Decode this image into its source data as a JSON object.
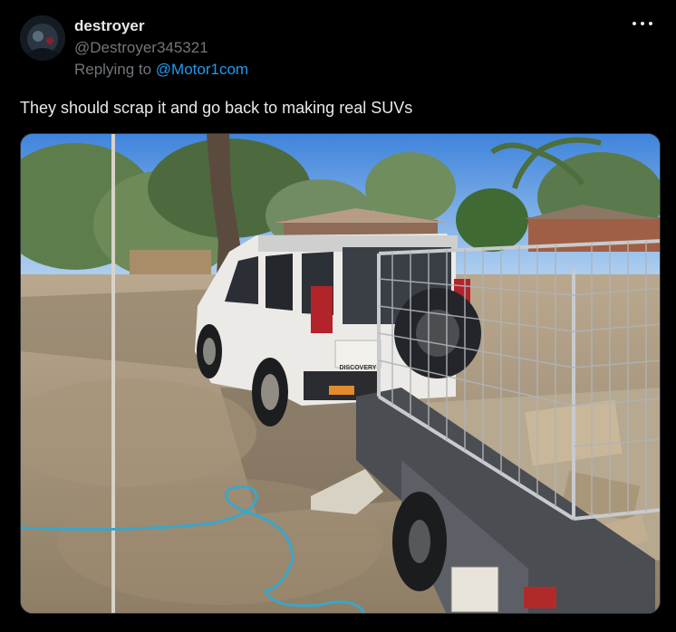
{
  "tweet": {
    "display_name": "destroyer",
    "handle": "@Destroyer345321",
    "replying_prefix": "Replying to ",
    "replying_mention": "@Motor1com",
    "text": "They should scrap it and go back to making real SUVs",
    "more_icon": "more-horizontal-icon"
  },
  "media": {
    "badge_text": "DISCOVERY"
  },
  "colors": {
    "background": "#000000",
    "text_primary": "#e7e9ea",
    "text_secondary": "#71767b",
    "link": "#1d9bf0"
  }
}
